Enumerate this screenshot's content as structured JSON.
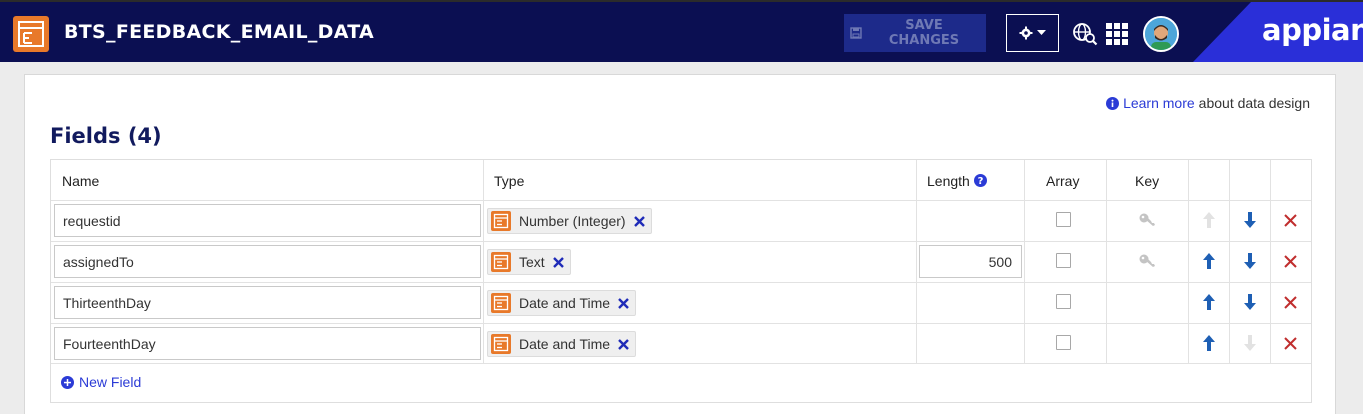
{
  "header": {
    "app_title": "BTS_FEEDBACK_EMAIL_DATA",
    "save_label": "SAVE CHANGES",
    "brand": "appian",
    "colors": {
      "navy": "#0b0f52",
      "brand_blue": "#2a2fd8",
      "orange": "#e8792a"
    }
  },
  "content": {
    "learn_more_link": "Learn more",
    "learn_more_suffix": "about data design",
    "fields_title": "Fields (4)",
    "columns": {
      "name": "Name",
      "type": "Type",
      "length": "Length",
      "array": "Array",
      "key": "Key"
    },
    "rows": [
      {
        "name": "requestid",
        "type": "Number (Integer)",
        "length": "",
        "key_visible": true,
        "up_enabled": false,
        "down_enabled": true
      },
      {
        "name": "assignedTo",
        "type": "Text",
        "length": "500",
        "key_visible": true,
        "up_enabled": true,
        "down_enabled": true
      },
      {
        "name": "ThirteenthDay",
        "type": "Date and Time",
        "length": "",
        "key_visible": false,
        "up_enabled": true,
        "down_enabled": true
      },
      {
        "name": "FourteenthDay",
        "type": "Date and Time",
        "length": "",
        "key_visible": false,
        "up_enabled": true,
        "down_enabled": false
      }
    ],
    "new_field_label": "New Field"
  }
}
